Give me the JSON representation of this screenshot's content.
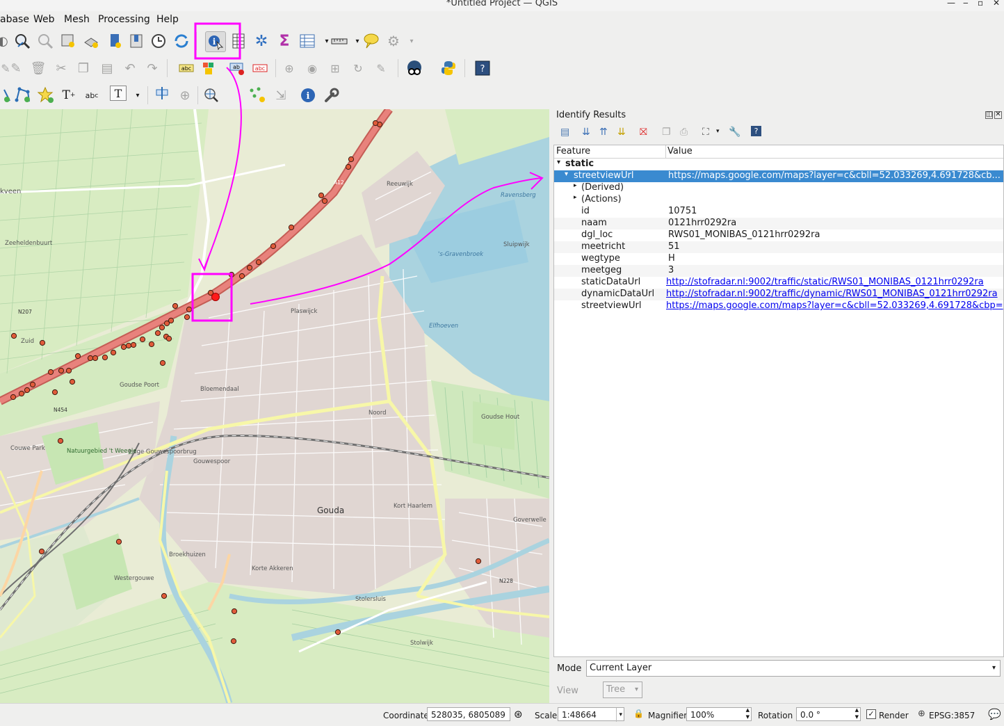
{
  "window": {
    "title": "*Untitled Project — QGIS",
    "minimize": "‒",
    "maximize": "▫",
    "close": "✕"
  },
  "menu": [
    "abase",
    "Web",
    "Mesh",
    "Processing",
    "Help"
  ],
  "map": {
    "labels": [
      "Reeuwijk",
      "Gouda",
      "Plaswijck",
      "Bloemendaal",
      "Noord",
      "Kort Haarlem",
      "Korte Akkeren",
      "Goverwelle",
      "Stolwijk",
      "Zuid",
      "Westergouwe",
      "Broekhuizen",
      "Hoge Gouwespoorbrug",
      "Zeeheldenbuurt",
      "kveen",
      "Stolersluis",
      "Ravensberg",
      "Sluipwijk",
      "'s-Gravenbroek",
      "Elfhoeven",
      "Goudse Hout",
      "N207",
      "N454",
      "N228",
      "A12",
      "Couwe Park",
      "Natuurgebied 't Weegje",
      "Gouwespoor",
      "Goudse Poort"
    ]
  },
  "identify": {
    "title": "Identify Results",
    "columns": {
      "feature": "Feature",
      "value": "Value"
    },
    "layer": "static",
    "selected": {
      "key": "streetviewUrl",
      "value": "https://maps.google.com/maps?layer=c&cbll=52.033269,4.691728&cb..."
    },
    "groups": [
      "(Derived)",
      "(Actions)"
    ],
    "attributes": [
      {
        "key": "id",
        "value": "10751",
        "link": false
      },
      {
        "key": "naam",
        "value": "0121hrr0292ra",
        "link": false
      },
      {
        "key": "dgl_loc",
        "value": "RWS01_MONIBAS_0121hrr0292ra",
        "link": false
      },
      {
        "key": "meetricht",
        "value": "51",
        "link": false
      },
      {
        "key": "wegtype",
        "value": "H",
        "link": false
      },
      {
        "key": "meetgeg",
        "value": "3",
        "link": false
      },
      {
        "key": "staticDataUrl",
        "value": "http://stofradar.nl:9002/traffic/static/RWS01_MONIBAS_0121hrr0292ra",
        "link": true
      },
      {
        "key": "dynamicDataUrl",
        "value": "http://stofradar.nl:9002/traffic/dynamic/RWS01_MONIBAS_0121hrr0292ra",
        "link": true
      },
      {
        "key": "streetviewUrl",
        "value": "https://maps.google.com/maps?layer=c&cbll=52.033269,4.691728&cbp=",
        "link": true
      }
    ],
    "mode_label": "Mode",
    "mode_value": "Current Layer",
    "view_label": "View",
    "view_value": "Tree"
  },
  "status": {
    "coordinate_label": "Coordinate",
    "coordinate_value": "528035, 6805089",
    "scale_label": "Scale",
    "scale_value": "1:48664",
    "magnifier_label": "Magnifier",
    "magnifier_value": "100%",
    "rotation_label": "Rotation",
    "rotation_value": "0.0 °",
    "render_label": "Render",
    "crs": "EPSG:3857"
  },
  "colors": {
    "annotation": "#ff00ff",
    "selection": "#3a8ad0",
    "motorway": "#e8827c",
    "water": "#aad3df",
    "link": "#0000ee"
  }
}
